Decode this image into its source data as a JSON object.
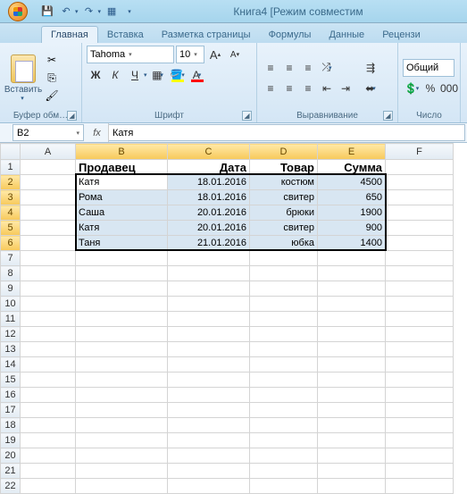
{
  "title": "Книга4  [Режим совместим",
  "tabs": [
    "Главная",
    "Вставка",
    "Разметка страницы",
    "Формулы",
    "Данные",
    "Рецензи"
  ],
  "active_tab": 0,
  "ribbon": {
    "clipboard": {
      "paste": "Вставить",
      "label": "Буфер обм…"
    },
    "font": {
      "name": "Tahoma",
      "size": "10",
      "label": "Шрифт",
      "bold": "Ж",
      "italic": "К",
      "underline": "Ч"
    },
    "align": {
      "label": "Выравнивание"
    },
    "number": {
      "format": "Общий",
      "label": "Число"
    }
  },
  "namebox": "B2",
  "formula": "Катя",
  "columns": [
    "A",
    "B",
    "C",
    "D",
    "E",
    "F"
  ],
  "row_count": 22,
  "headers": {
    "B": "Продавец",
    "C": "Дата",
    "D": "Товар",
    "E": "Сумма"
  },
  "rows": [
    {
      "B": "Катя",
      "C": "18.01.2016",
      "D": "костюм",
      "E": "4500"
    },
    {
      "B": "Рома",
      "C": "18.01.2016",
      "D": "свитер",
      "E": "650"
    },
    {
      "B": "Саша",
      "C": "20.01.2016",
      "D": "брюки",
      "E": "1900"
    },
    {
      "B": "Катя",
      "C": "20.01.2016",
      "D": "свитер",
      "E": "900"
    },
    {
      "B": "Таня",
      "C": "21.01.2016",
      "D": "юбка",
      "E": "1400"
    }
  ],
  "chart_data": {
    "type": "table",
    "columns": [
      "Продавец",
      "Дата",
      "Товар",
      "Сумма"
    ],
    "rows": [
      [
        "Катя",
        "18.01.2016",
        "костюм",
        4500
      ],
      [
        "Рома",
        "18.01.2016",
        "свитер",
        650
      ],
      [
        "Саша",
        "20.01.2016",
        "брюки",
        1900
      ],
      [
        "Катя",
        "20.01.2016",
        "свитер",
        900
      ],
      [
        "Таня",
        "21.01.2016",
        "юбка",
        1400
      ]
    ]
  }
}
